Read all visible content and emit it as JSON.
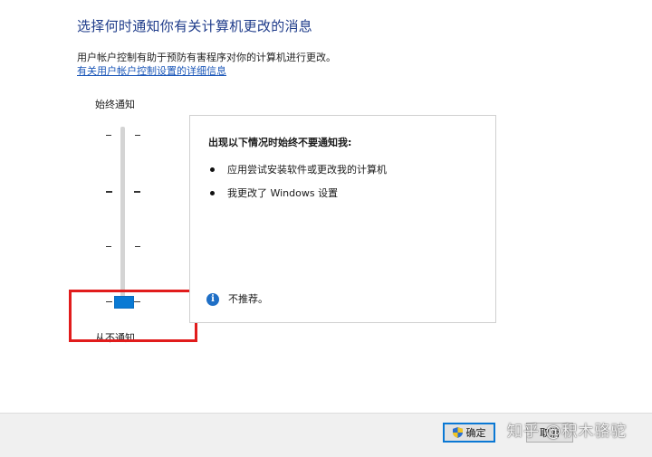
{
  "header": {
    "title": "选择何时通知你有关计算机更改的消息",
    "description": "用户帐户控制有助于预防有害程序对你的计算机进行更改。",
    "link": "有关用户帐户控制设置的详细信息"
  },
  "slider": {
    "top_label": "始终通知",
    "bottom_label": "从不通知",
    "levels": 4,
    "selected_level": 1
  },
  "panel": {
    "heading": "出现以下情况时始终不要通知我:",
    "bullets": [
      "应用尝试安装软件或更改我的计算机",
      "我更改了 Windows 设置"
    ],
    "info_text": "不推荐。"
  },
  "footer": {
    "ok_label": "确定",
    "cancel_label": "取消"
  },
  "watermark": "知乎 @积木骆驼",
  "colors": {
    "title": "#1e3b8a",
    "accent": "#0a7ad4",
    "highlight": "#e11c1c"
  }
}
